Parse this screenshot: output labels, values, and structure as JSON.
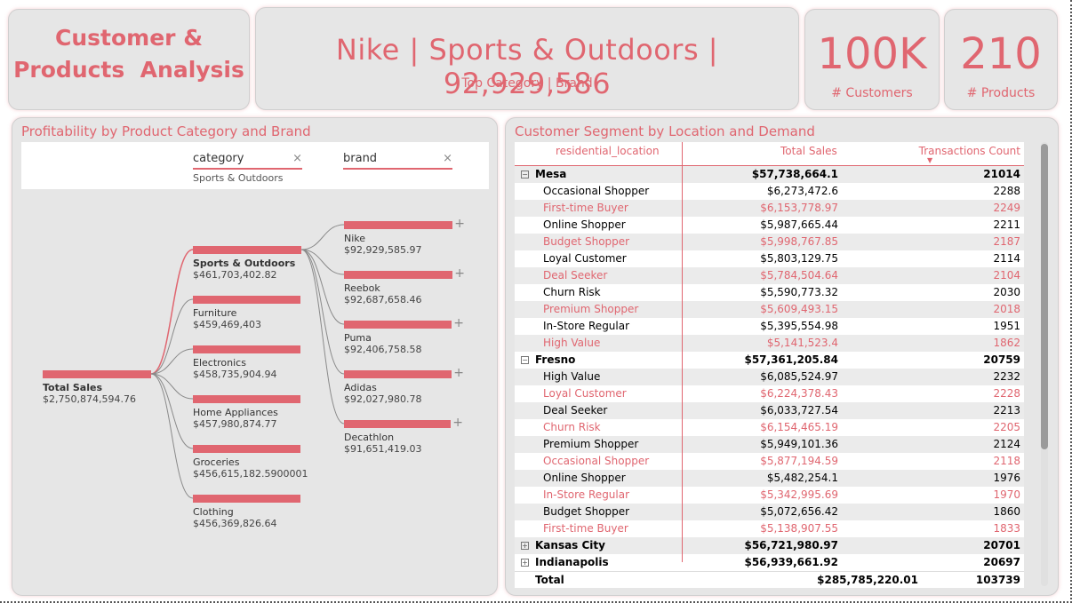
{
  "title_card": {
    "title": "Customer &\nProducts  Analysis"
  },
  "brand_card": {
    "headline": "Nike | Sports & Outdoors | 92,929,586",
    "subtitle": "Top Category | Brand"
  },
  "kpis": {
    "customers": {
      "value": "100K",
      "label": "# Customers"
    },
    "products": {
      "value": "210",
      "label": "# Products"
    }
  },
  "tree": {
    "panel_title": "Profitability by Product Category and Brand",
    "filters": [
      {
        "name": "category",
        "selected": "Sports & Outdoors"
      },
      {
        "name": "brand",
        "selected": ""
      }
    ],
    "close_glyph": "×",
    "expand_glyph": "+",
    "root": {
      "label": "Total Sales",
      "value": "$2,750,874,594.76"
    },
    "categories": [
      {
        "label": "Sports & Outdoors",
        "value": "$461,703,402.82",
        "bar_fraction": 1.0
      },
      {
        "label": "Furniture",
        "value": "$459,469,403",
        "bar_fraction": 0.995
      },
      {
        "label": "Electronics",
        "value": "$458,735,904.94",
        "bar_fraction": 0.994
      },
      {
        "label": "Home Appliances",
        "value": "$457,980,874.77",
        "bar_fraction": 0.992
      },
      {
        "label": "Groceries",
        "value": "$456,615,182.5900001",
        "bar_fraction": 0.989
      },
      {
        "label": "Clothing",
        "value": "$456,369,826.64",
        "bar_fraction": 0.988
      }
    ],
    "brands": [
      {
        "label": "Nike",
        "value": "$92,929,585.97",
        "bar_fraction": 1.0
      },
      {
        "label": "Reebok",
        "value": "$92,687,658.46",
        "bar_fraction": 0.997
      },
      {
        "label": "Puma",
        "value": "$92,406,758.58",
        "bar_fraction": 0.994
      },
      {
        "label": "Adidas",
        "value": "$92,027,980.78",
        "bar_fraction": 0.99
      },
      {
        "label": "Decathlon",
        "value": "$91,651,419.03",
        "bar_fraction": 0.986
      }
    ]
  },
  "table": {
    "panel_title": "Customer Segment by Location and Demand",
    "headers": [
      "residential_location",
      "Total Sales",
      "Transactions Count"
    ],
    "sort_glyph": "▼",
    "collapse_glyph": "−",
    "expand_glyph": "+",
    "groups": [
      {
        "name": "Mesa",
        "sales": "$57,738,664.1",
        "count": "21014",
        "expanded": true,
        "rows": [
          [
            "Occasional Shopper",
            "$6,273,472.6",
            "2288"
          ],
          [
            "First-time Buyer",
            "$6,153,778.97",
            "2249"
          ],
          [
            "Online Shopper",
            "$5,987,665.44",
            "2211"
          ],
          [
            "Budget Shopper",
            "$5,998,767.85",
            "2187"
          ],
          [
            "Loyal Customer",
            "$5,803,129.75",
            "2114"
          ],
          [
            "Deal Seeker",
            "$5,784,504.64",
            "2104"
          ],
          [
            "Churn Risk",
            "$5,590,773.32",
            "2030"
          ],
          [
            "Premium Shopper",
            "$5,609,493.15",
            "2018"
          ],
          [
            "In-Store Regular",
            "$5,395,554.98",
            "1951"
          ],
          [
            "High Value",
            "$5,141,523.4",
            "1862"
          ]
        ]
      },
      {
        "name": "Fresno",
        "sales": "$57,361,205.84",
        "count": "20759",
        "expanded": true,
        "rows": [
          [
            "High Value",
            "$6,085,524.97",
            "2232"
          ],
          [
            "Loyal Customer",
            "$6,224,378.43",
            "2228"
          ],
          [
            "Deal Seeker",
            "$6,033,727.54",
            "2213"
          ],
          [
            "Churn Risk",
            "$6,154,465.19",
            "2205"
          ],
          [
            "Premium Shopper",
            "$5,949,101.36",
            "2124"
          ],
          [
            "Occasional Shopper",
            "$5,877,194.59",
            "2118"
          ],
          [
            "Online Shopper",
            "$5,482,254.1",
            "1976"
          ],
          [
            "In-Store Regular",
            "$5,342,995.69",
            "1970"
          ],
          [
            "Budget Shopper",
            "$5,072,656.42",
            "1860"
          ],
          [
            "First-time Buyer",
            "$5,138,907.55",
            "1833"
          ]
        ]
      },
      {
        "name": "Kansas City",
        "sales": "$56,721,980.97",
        "count": "20701",
        "expanded": false,
        "rows": []
      },
      {
        "name": "Indianapolis",
        "sales": "$56,939,661.92",
        "count": "20697",
        "expanded": false,
        "rows": []
      }
    ],
    "total": {
      "label": "Total",
      "sales": "$285,785,220.01",
      "count": "103739"
    }
  },
  "colors": {
    "accent": "#e06670",
    "card_bg": "#e6e6e6",
    "text": "#333333"
  }
}
